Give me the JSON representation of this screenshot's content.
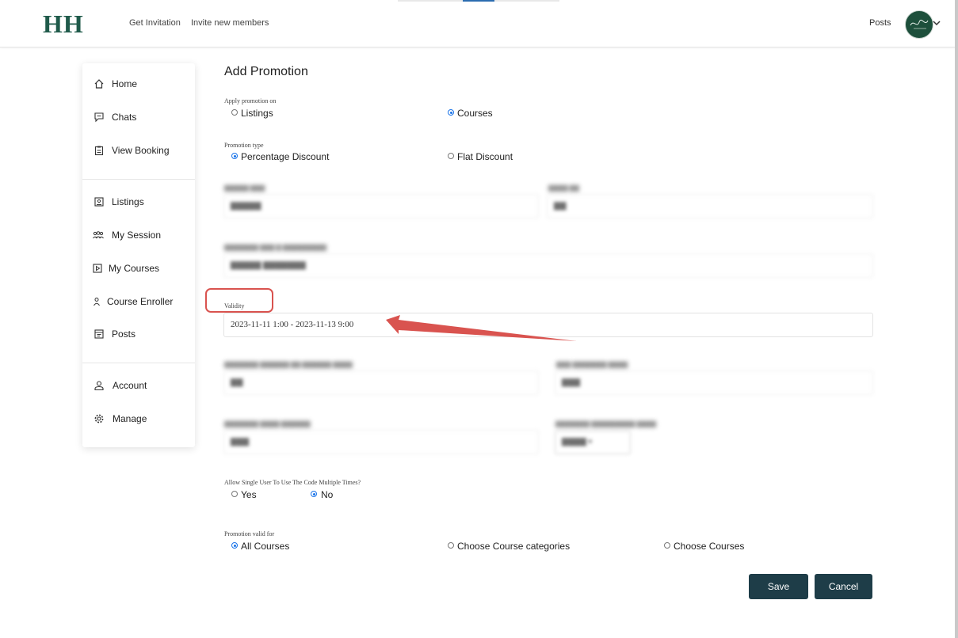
{
  "header": {
    "logo": "HH",
    "nav": [
      "Get Invitation",
      "Invite new members"
    ],
    "posts_link": "Posts"
  },
  "sidebar": {
    "items": [
      {
        "label": "Home",
        "icon": "home-icon"
      },
      {
        "label": "Chats",
        "icon": "chat-icon"
      },
      {
        "label": "View Booking",
        "icon": "clipboard-icon"
      },
      {
        "label": "Listings",
        "icon": "listing-icon"
      },
      {
        "label": "My Session",
        "icon": "group-icon"
      },
      {
        "label": "My Courses",
        "icon": "play-icon"
      },
      {
        "label": "Course Enroller",
        "icon": "person-icon"
      },
      {
        "label": "Posts",
        "icon": "posts-icon"
      },
      {
        "label": "Account",
        "icon": "user-icon"
      },
      {
        "label": "Manage",
        "icon": "gear-icon"
      }
    ]
  },
  "form": {
    "title": "Add Promotion",
    "apply_on": {
      "label": "Apply promotion on",
      "options": [
        "Listings",
        "Courses"
      ],
      "selected": "Courses"
    },
    "promotion_type": {
      "label": "Promotion type",
      "options": [
        "Percentage Discount",
        "Flat Discount"
      ],
      "selected": "Percentage Discount"
    },
    "validity": {
      "label": "Validity",
      "value": "2023-11-11 1:00 - 2023-11-13 9:00"
    },
    "multiple_use": {
      "label": "Allow Single User To Use The Code Multiple Times?",
      "options": [
        "Yes",
        "No"
      ],
      "selected": "No"
    },
    "valid_for": {
      "label": "Promotion valid for",
      "options": [
        "All Courses",
        "Choose Course categories",
        "Choose Courses"
      ],
      "selected": "All Courses"
    },
    "save_label": "Save",
    "cancel_label": "Cancel"
  },
  "colors": {
    "brand": "#1f5a4a",
    "button": "#1e3d48",
    "radio_selected": "#1a73e8",
    "annotation": "#d9534f"
  }
}
